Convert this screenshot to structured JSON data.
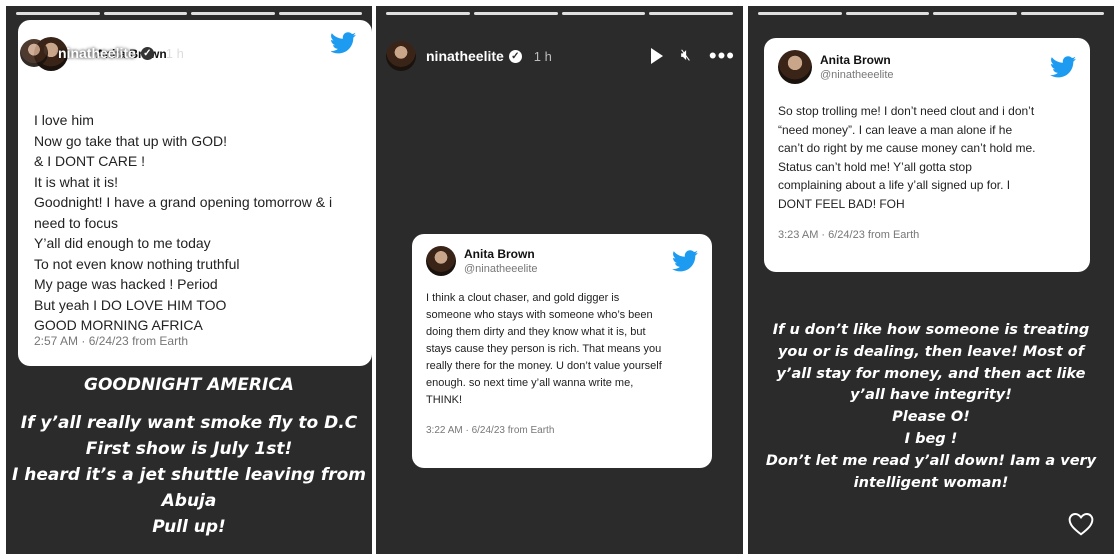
{
  "panels": [
    {
      "username": "ninatheelite",
      "time": "1 h",
      "tweet": {
        "name": "Anita Brown",
        "lines": [
          "I love him",
          "Now go take that up with GOD!",
          "& I DONT CARE !",
          "It is what it is!",
          "Goodnight! I have a grand opening tomorrow & i",
          "need to focus",
          "Y’all did enough to me today",
          "To not even know nothing truthful",
          "My page was hacked ! Period",
          "But yeah I DO LOVE HIM TOO",
          "GOOD MORNING AFRICA"
        ],
        "footer": "2:57 AM · 6/24/23 from Earth"
      },
      "overlay": [
        "GOODNIGHT AMERICA",
        "",
        "If y’all really want smoke fly to D.C",
        "First show is July 1st!",
        "I heard it’s a jet shuttle leaving from",
        "Abuja",
        "Pull up!"
      ]
    },
    {
      "username": "ninatheelite",
      "time": "1 h",
      "tweet": {
        "name": "Anita Brown",
        "handle": "@ninatheeelite",
        "lines": [
          "I think a clout chaser, and gold digger is",
          "someone who stays with someone who’s been",
          "doing them dirty and they know what it is, but",
          "stays cause they person is rich. That means you",
          "really there for the money. U don’t value yourself",
          "enough. so next time y’all wanna write me,",
          "THINK!"
        ],
        "footer": "3:22 AM · 6/24/23 from Earth"
      }
    },
    {
      "tweet": {
        "name": "Anita Brown",
        "handle": "@ninatheeelite",
        "lines": [
          "So stop trolling me! I don’t need clout and i don’t",
          "“need money”. I can leave a man alone if he",
          "can’t do right by me cause money can’t hold me.",
          "Status can’t hold me! Y’all gotta stop",
          "complaining about a life y’all signed up for. I",
          "DONT FEEL BAD! FOH"
        ],
        "footer": "3:23 AM · 6/24/23 from Earth"
      },
      "overlay": [
        "If u don’t like how someone is treating",
        "you or is dealing, then leave! Most of",
        "y’all stay for money, and then act like",
        "y’all have integrity!",
        "Please O!",
        "I beg !",
        "Don’t let me read y’all down! Iam a very",
        "intelligent woman!"
      ]
    }
  ],
  "colors": {
    "twitter_blue": "#1d9bf0",
    "story_bg": "#2b2b2b"
  },
  "icons": [
    "twitter-bird-icon",
    "pause-icon",
    "play-icon",
    "mute-icon",
    "more-icon",
    "heart-icon",
    "verified-icon"
  ]
}
